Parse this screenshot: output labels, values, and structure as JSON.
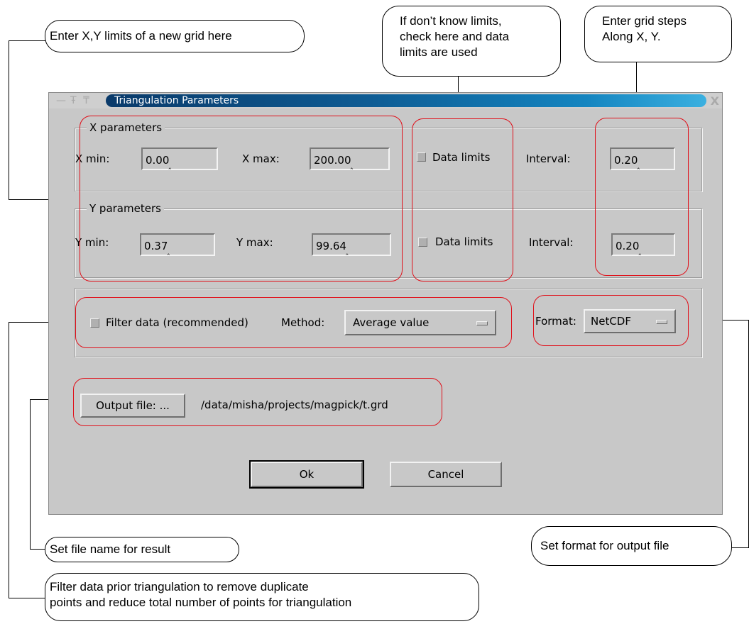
{
  "callouts": {
    "limits": "Enter X,Y limits of a new grid here",
    "data_limits": [
      "If don’t know limits,",
      "check here and data",
      "limits are used"
    ],
    "grid_steps": [
      "Enter grid steps",
      "Along X, Y."
    ],
    "file_name": "Set file name for result",
    "format": "Set format for output file",
    "filter": [
      "Filter data prior triangulation to remove duplicate",
      "points and reduce total number of points for triangulation"
    ]
  },
  "dialog": {
    "title": "Triangulation Parameters",
    "x_group": {
      "legend": "X parameters",
      "min_label": "X min:",
      "min_value": "0.00",
      "max_label": "X max:",
      "max_value": "200.00",
      "data_limits_label": "Data limits",
      "interval_label": "Interval:",
      "interval_value": "0.20"
    },
    "y_group": {
      "legend": "Y parameters",
      "min_label": "Y min:",
      "min_value": "0.37",
      "max_label": "Y max:",
      "max_value": "99.64",
      "data_limits_label": "Data limits",
      "interval_label": "Interval:",
      "interval_value": "0.20"
    },
    "filter": {
      "checkbox_label": "Filter data (recommended)",
      "method_label": "Method:",
      "method_value": "Average value",
      "format_label": "Format:",
      "format_value": "NetCDF"
    },
    "output": {
      "button_label": "Output file: ...",
      "path": "/data/misha/projects/magpick/t.grd"
    },
    "ok_label": "Ok",
    "cancel_label": "Cancel"
  }
}
